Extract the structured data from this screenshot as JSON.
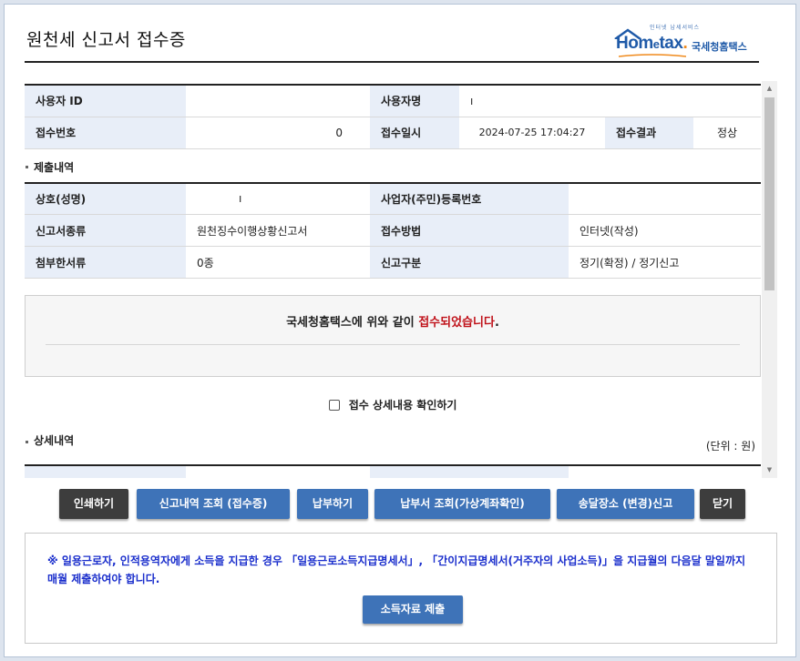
{
  "page": {
    "title": "원천세 신고서 접수증"
  },
  "logo": {
    "tagline": "인터넷 납세서비스",
    "brand_main": "Hom",
    "brand_e": "e",
    "brand_rest": "tax",
    "brand_dot": ".",
    "korean": "국세청홈택스"
  },
  "receipt": {
    "user_id_label": "사용자 ID",
    "user_id_value": "",
    "user_name_label": "사용자명",
    "user_name_value": "ı",
    "receipt_no_label": "접수번호",
    "receipt_no_value": "0",
    "receipt_datetime_label": "접수일시",
    "receipt_datetime_value": "2024-07-25 17:04:27",
    "result_label": "접수결과",
    "result_value": "정상"
  },
  "submission": {
    "section_title": "제출내역",
    "company_label": "상호(성명)",
    "company_value": "ı",
    "regno_label": "사업자(주민)등록번호",
    "regno_value": "",
    "form_type_label": "신고서종류",
    "form_type_value": "원천징수이행상황신고서",
    "method_label": "접수방법",
    "method_value": "인터넷(작성)",
    "attach_label": "첨부한서류",
    "attach_value": "0종",
    "category_label": "신고구분",
    "category_value": "정기(확정) / 정기신고"
  },
  "notice": {
    "prefix": "국세청홈택스에 위와 같이 ",
    "highlight": "접수되었습니다",
    "suffix": "."
  },
  "confirm_checkbox": {
    "label": "접수 상세내용 확인하기",
    "checked": false
  },
  "details": {
    "section_title": "상세내역",
    "unit": "(단위 : 원)"
  },
  "buttons": {
    "print": "인쇄하기",
    "history": "신고내역 조회 (접수증)",
    "pay": "납부하기",
    "payment_slip": "납부서 조회(가상계좌확인)",
    "delivery": "송달장소 (변경)신고",
    "close": "닫기"
  },
  "footer": {
    "notice": "※ 일용근로자, 인적용역자에게 소득을 지급한 경우 「일용근로소득지급명세서」, 「간이지급명세서(거주자의 사업소득)」을 지급월의 다음달 말일까지 매월 제출하여야 합니다.",
    "submit_button": "소득자료 제출"
  },
  "colors": {
    "accent_blue": "#3e73b8",
    "dark_button": "#3d3d3d",
    "header_cell": "#e8eef8",
    "highlight_red": "#c0121a",
    "notice_blue": "#1a2ecc"
  }
}
